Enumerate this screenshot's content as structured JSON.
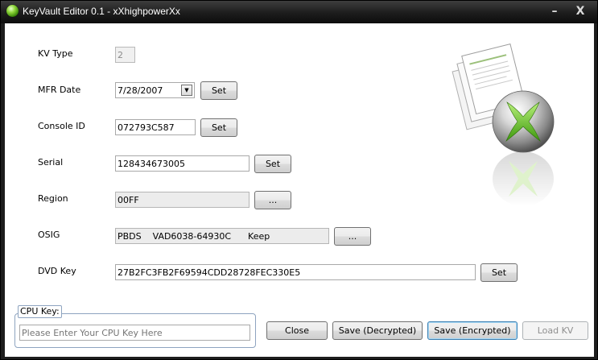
{
  "window": {
    "title": "KeyVault Editor 0.1 - xXhighpowerXx",
    "minimize_glyph": "–",
    "close_glyph": "X"
  },
  "form": {
    "kv_type": {
      "label": "KV Type",
      "value": "2"
    },
    "mfr_date": {
      "label": "MFR Date",
      "value": "7/28/2007",
      "button": "Set"
    },
    "console_id": {
      "label": "Console ID",
      "value": "072793C587",
      "button": "Set"
    },
    "serial": {
      "label": "Serial",
      "value": "128434673005",
      "button": "Set"
    },
    "region": {
      "label": "Region",
      "value": "00FF",
      "button": "..."
    },
    "osig": {
      "label": "OSIG",
      "value": "PBDS    VAD6038-64930C      Keep",
      "button": "..."
    },
    "dvd_key": {
      "label": "DVD Key",
      "value": "27B2FC3FB2F69594CDD28728FEC330E5",
      "button": "Set"
    }
  },
  "cpu_key": {
    "group_label": "CPU Key:",
    "placeholder": "Please Enter Your CPU Key Here"
  },
  "actions": {
    "close": "Close",
    "save_decrypted": "Save (Decrypted)",
    "save_encrypted": "Save (Encrypted)",
    "load_kv": "Load KV"
  },
  "icons": {
    "app": "xbox-orb-icon",
    "logo": "xbox-logo-with-documents"
  },
  "colors": {
    "titlebar": "#1c1c1c",
    "xbox_green": "#5dbb1e"
  }
}
